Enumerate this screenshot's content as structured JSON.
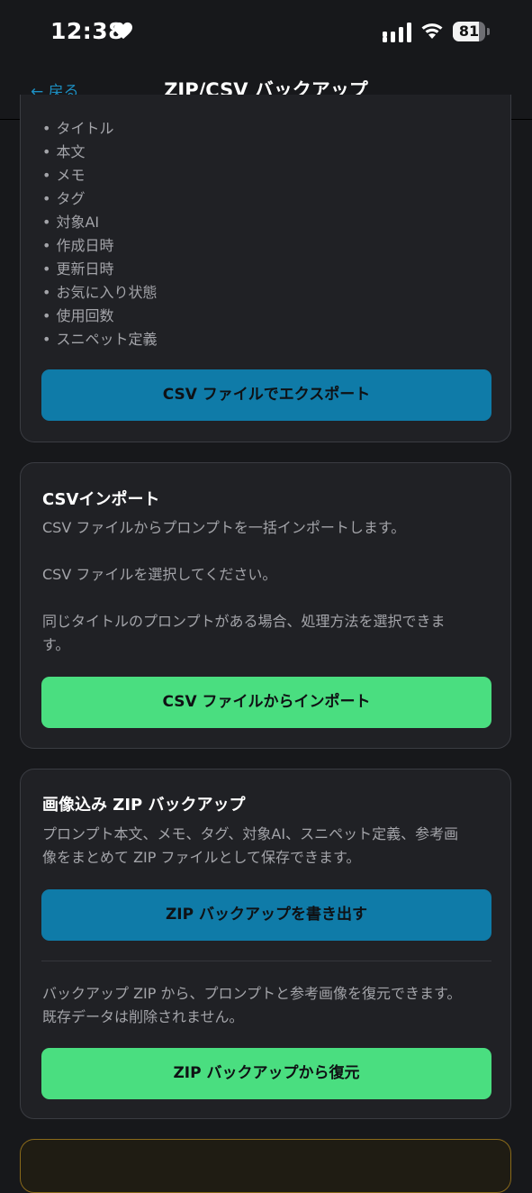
{
  "status_bar": {
    "time": "12:38",
    "battery": "81",
    "battery_level": 0.81
  },
  "nav": {
    "back_label": "← 戻る",
    "title": "ZIP/CSV バックアップ"
  },
  "export_card": {
    "fields": [
      "タイトル",
      "本文",
      "メモ",
      "タグ",
      "対象AI",
      "作成日時",
      "更新日時",
      "お気に入り状態",
      "使用回数",
      "スニペット定義"
    ],
    "button_label": "CSV ファイルでエクスポート"
  },
  "import_card": {
    "title": "CSVインポート",
    "desc1": "CSV ファイルからプロンプトを一括インポートします。",
    "desc2": "CSV ファイルを選択してください。",
    "desc3_line1": "同じタイトルのプロンプトがある場合、処理方法を選択できま",
    "desc3_line2": "す。",
    "button_label": "CSV ファイルからインポート"
  },
  "zip_card": {
    "title": "画像込み ZIP バックアップ",
    "desc1_line1": "プロンプト本文、メモ、タグ、対象AI、スニペット定義、参考画",
    "desc1_line2": "像をまとめて ZIP ファイルとして保存できます。",
    "export_button_label": "ZIP バックアップを書き出す",
    "desc2_line1": "バックアップ ZIP から、プロンプトと参考画像を復元できます。",
    "desc2_line2": "既存データは削除されません。",
    "restore_button_label": "ZIP バックアップから復元"
  },
  "colors": {
    "accent_blue": "#0f7ba8",
    "accent_green": "#4ade80",
    "link": "#1d8fc2",
    "warning_border": "#8a6a1a"
  }
}
